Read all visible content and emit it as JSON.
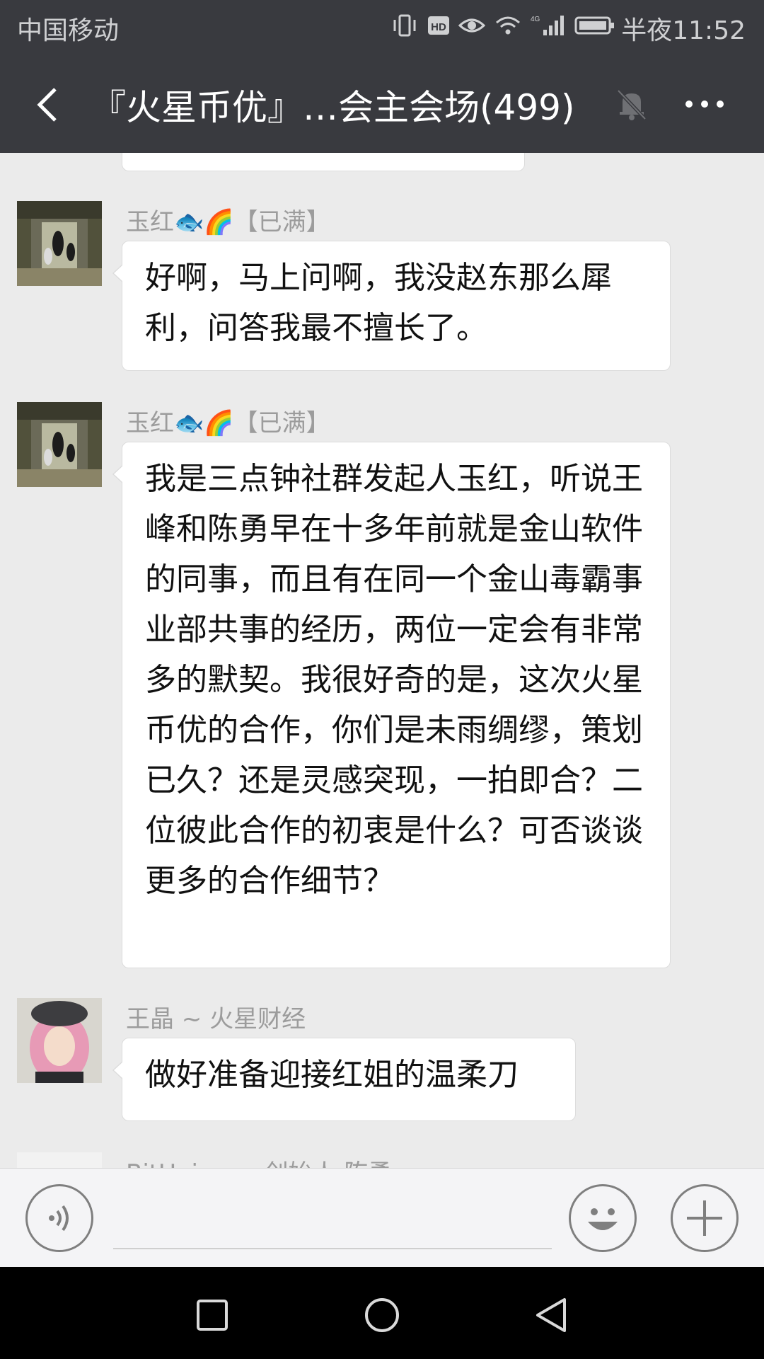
{
  "status_bar": {
    "carrier": "中国移动",
    "time": "半夜11:52",
    "icons": [
      "vibrate-icon",
      "hd-icon",
      "eye-icon",
      "wifi-icon",
      "4g-signal-icon",
      "battery-icon"
    ]
  },
  "header": {
    "title": "『火星币优』…会主会场(499)",
    "back_icon": "back-arrow-icon",
    "mute_icon": "mute-bell-icon",
    "more_icon": "more-dots-icon"
  },
  "messages": [
    {
      "sender": "玉红🐟🌈【已满】",
      "text": "好啊，马上问啊，我没赵东那么犀利，问答我最不擅长了。"
    },
    {
      "sender": "玉红🐟🌈【已满】",
      "text": "我是三点钟社群发起人玉红，听说王峰和陈勇早在十多年前就是金山软件的同事，而且有在同一个金山毒霸事业部共事的经历，两位一定会有非常多的默契。我很好奇的是，这次火星币优的合作，你们是未雨绸缪，策划已久？还是灵感突现，一拍即合？二位彼此合作的初衷是什么？可否谈谈更多的合作细节？"
    },
    {
      "sender": "王晶 ~ 火星财经",
      "text": "做好准备迎接红姐的温柔刀"
    },
    {
      "sender": "BitUniverse创始人 陈勇",
      "text": ""
    }
  ],
  "input_bar": {
    "voice_icon": "voice-icon",
    "emoji_icon": "emoji-icon",
    "plus_icon": "plus-icon"
  },
  "nav_bar": {
    "icons": [
      "recents-square-icon",
      "home-circle-icon",
      "back-triangle-icon"
    ]
  },
  "colors": {
    "header_bg": "#393a3f",
    "chat_bg": "#ebebeb",
    "bubble_bg": "#ffffff",
    "nav_bg": "#000000"
  }
}
